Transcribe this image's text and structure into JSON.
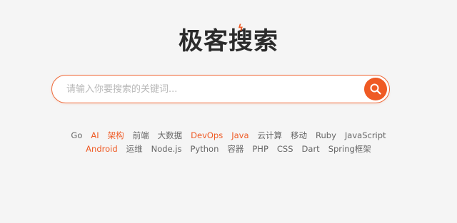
{
  "logo": {
    "text": "极客搜索",
    "accent_color": "#ef5a24"
  },
  "search": {
    "placeholder": "请输入你要搜索的关键词...",
    "value": "",
    "button_icon": "search-icon"
  },
  "tags": [
    {
      "label": "Go",
      "hot": false
    },
    {
      "label": "AI",
      "hot": true
    },
    {
      "label": "架构",
      "hot": true
    },
    {
      "label": "前端",
      "hot": false
    },
    {
      "label": "大数据",
      "hot": false
    },
    {
      "label": "DevOps",
      "hot": true
    },
    {
      "label": "Java",
      "hot": true
    },
    {
      "label": "云计算",
      "hot": false
    },
    {
      "label": "移动",
      "hot": false
    },
    {
      "label": "Ruby",
      "hot": false
    },
    {
      "label": "JavaScript",
      "hot": false
    },
    {
      "label": "Android",
      "hot": true
    },
    {
      "label": "运维",
      "hot": false
    },
    {
      "label": "Node.js",
      "hot": false
    },
    {
      "label": "Python",
      "hot": false
    },
    {
      "label": "容器",
      "hot": false
    },
    {
      "label": "PHP",
      "hot": false
    },
    {
      "label": "CSS",
      "hot": false
    },
    {
      "label": "Dart",
      "hot": false
    },
    {
      "label": "Spring框架",
      "hot": false
    }
  ],
  "colors": {
    "background": "#f5f5f5",
    "tag_default": "#666666",
    "tag_hot": "#ef5a24"
  }
}
